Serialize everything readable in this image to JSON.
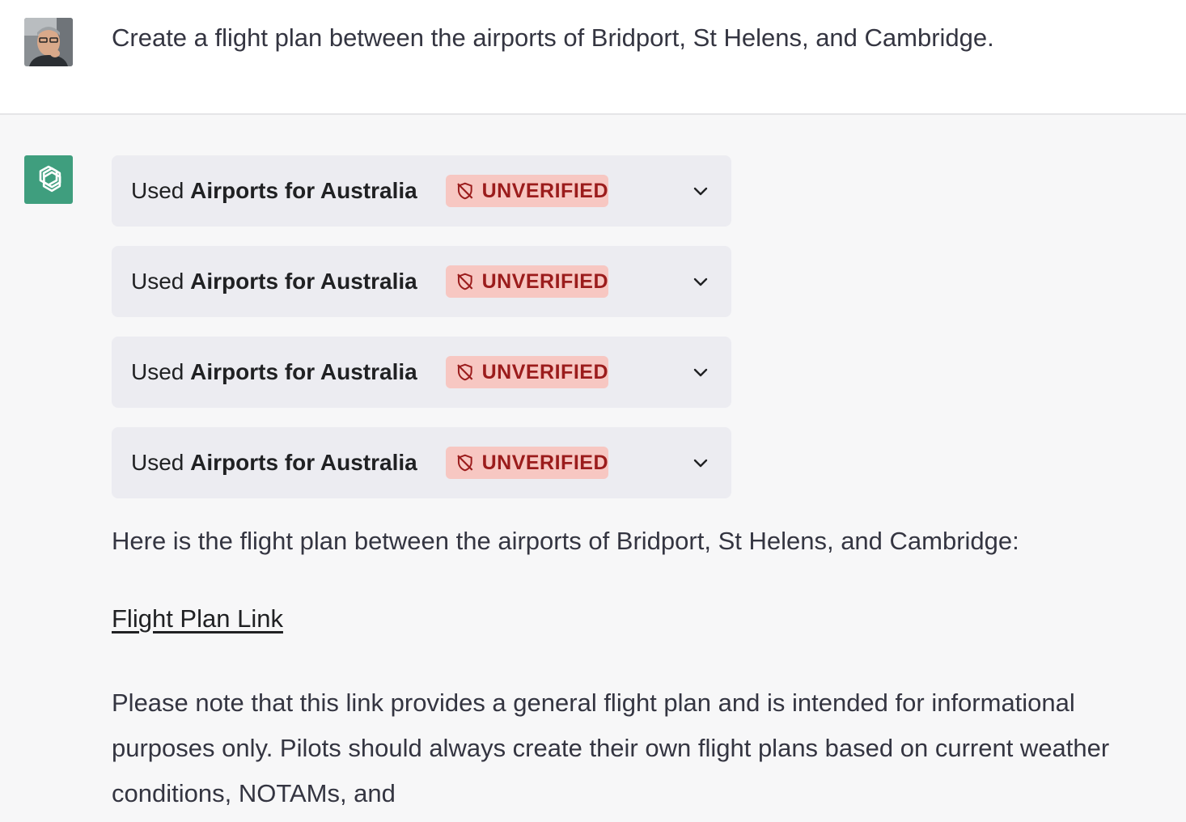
{
  "user_message": {
    "text": "Create a flight plan between the airports of Bridport, St Helens, and Cambridge."
  },
  "assistant": {
    "tool_calls": [
      {
        "prefix": "Used",
        "plugin": "Airports for Australia",
        "badge": "UNVERIFIED"
      },
      {
        "prefix": "Used",
        "plugin": "Airports for Australia",
        "badge": "UNVERIFIED"
      },
      {
        "prefix": "Used",
        "plugin": "Airports for Australia",
        "badge": "UNVERIFIED"
      },
      {
        "prefix": "Used",
        "plugin": "Airports for Australia",
        "badge": "UNVERIFIED"
      }
    ],
    "intro": "Here is the flight plan between the airports of Bridport, St Helens, and Cambridge:",
    "link_text": "Flight Plan Link",
    "note_lines": [
      "Please note that this link provides a general flight plan and is intended for informational",
      "purposes only. Pilots should always create their own flight plans based on current weather",
      "conditions, NOTAMs, and"
    ]
  },
  "colors": {
    "badge_bg": "#f7c7c2",
    "badge_text": "#9b1c1c",
    "assistant_avatar": "#3f9e7e",
    "card_bg": "#ececf1"
  }
}
